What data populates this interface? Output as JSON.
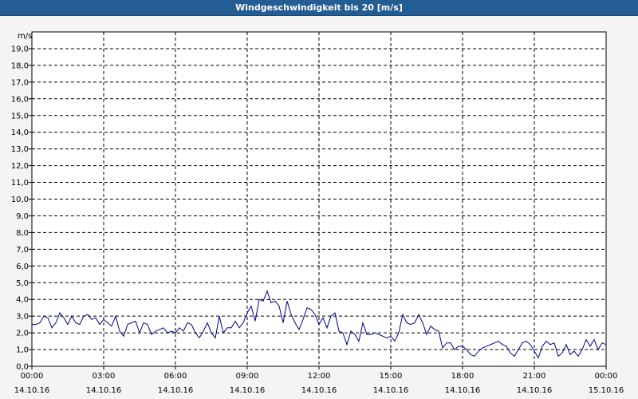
{
  "window": {
    "title": "Windgeschwindigkeit bis 20 [m/s]"
  },
  "colors": {
    "titlebar": "#245c94",
    "series": "#00008b",
    "grid": "#000000",
    "background": "#f4f4f4"
  },
  "chart_data": {
    "type": "line",
    "title": "Windgeschwindigkeit bis 20 [m/s]",
    "ylabel": "m/s",
    "xlabel": "",
    "ylim": [
      0,
      20
    ],
    "xlim": [
      0,
      24
    ],
    "grid": true,
    "y_ticks": [
      "0,0",
      "1,0",
      "2,0",
      "3,0",
      "4,0",
      "5,0",
      "6,0",
      "7,0",
      "8,0",
      "9,0",
      "10,0",
      "11,0",
      "12,0",
      "13,0",
      "14,0",
      "15,0",
      "16,0",
      "17,0",
      "18,0",
      "19,0"
    ],
    "x_ticks": [
      {
        "time": "00:00",
        "date": "14.10.16"
      },
      {
        "time": "03:00",
        "date": "14.10.16"
      },
      {
        "time": "06:00",
        "date": "14.10.16"
      },
      {
        "time": "09:00",
        "date": "14.10.16"
      },
      {
        "time": "12:00",
        "date": "14.10.16"
      },
      {
        "time": "15:00",
        "date": "14.10.16"
      },
      {
        "time": "18:00",
        "date": "14.10.16"
      },
      {
        "time": "21:00",
        "date": "14.10.16"
      },
      {
        "time": "00:00",
        "date": "15.10.16"
      }
    ],
    "series": [
      {
        "x_start": "14.10.16 00:00",
        "x_end": "14.10.16 23:50",
        "values": [
          2.5,
          2.5,
          2.6,
          3.0,
          2.9,
          2.3,
          2.6,
          3.2,
          2.9,
          2.5,
          3.0,
          2.6,
          2.5,
          3.0,
          3.1,
          2.8,
          2.9,
          2.5,
          2.8,
          2.6,
          2.4,
          3.0,
          2.1,
          1.8,
          2.5,
          2.6,
          2.7,
          2.0,
          2.6,
          2.5,
          1.9,
          2.1,
          2.2,
          2.3,
          2.0,
          2.1,
          2.0,
          2.3,
          2.1,
          2.6,
          2.5,
          2.0,
          1.7,
          2.1,
          2.6,
          2.0,
          1.7,
          3.0,
          2.0,
          2.3,
          2.3,
          2.7,
          2.3,
          2.6,
          3.2,
          3.6,
          2.7,
          4.0,
          3.9,
          4.5,
          3.8,
          3.9,
          3.6,
          2.6,
          3.9,
          3.1,
          2.6,
          2.2,
          2.8,
          3.5,
          3.4,
          3.1,
          2.5,
          2.9,
          2.3,
          3.0,
          3.2,
          2.1,
          2.0,
          1.3,
          2.1,
          1.9,
          1.5,
          2.6,
          1.9,
          1.9,
          2.0,
          1.9,
          1.8,
          1.7,
          1.8,
          1.5,
          2.0,
          3.1,
          2.6,
          2.5,
          2.6,
          3.1,
          2.6,
          1.9,
          2.4,
          2.2,
          2.1,
          1.1,
          1.4,
          1.4,
          1.0,
          1.2,
          1.2,
          1.0,
          0.7,
          0.6,
          0.9,
          1.1,
          1.2,
          1.3,
          1.4,
          1.5,
          1.3,
          1.2,
          0.8,
          0.6,
          1.0,
          1.4,
          1.5,
          1.3,
          0.9,
          0.5,
          1.2,
          1.5,
          1.3,
          1.4,
          0.6,
          0.8,
          1.3,
          0.7,
          0.9,
          0.6,
          1.0,
          1.6,
          1.2,
          1.6,
          1.0,
          1.4,
          1.3
        ]
      }
    ]
  }
}
